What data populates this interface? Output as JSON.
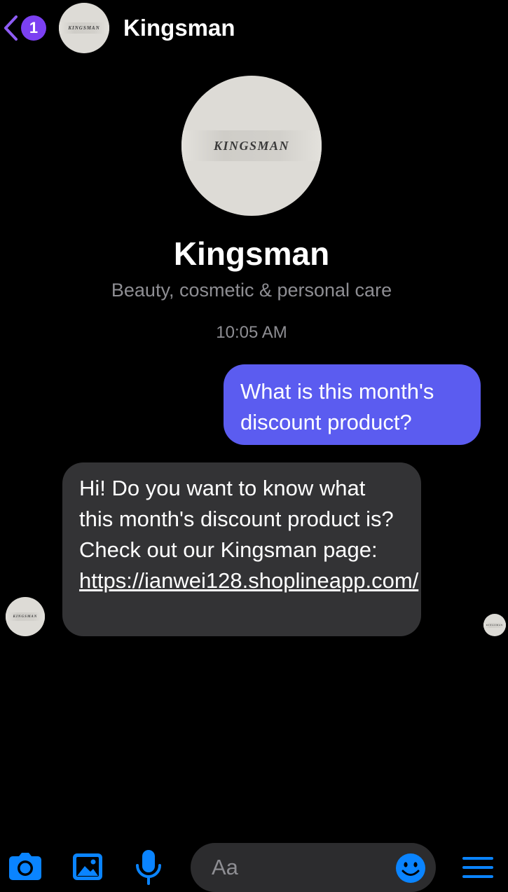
{
  "header": {
    "title": "Kingsman",
    "unread_count": "1",
    "avatar_text": "KINGSMAN"
  },
  "profile": {
    "name": "Kingsman",
    "category": "Beauty, cosmetic & personal care",
    "avatar_text": "KINGSMAN"
  },
  "conversation": {
    "timestamp": "10:05 AM",
    "messages": [
      {
        "direction": "outgoing",
        "text": "What is this month's discount product?"
      },
      {
        "direction": "incoming",
        "text": "Hi! Do you want to know what this month's discount product is? Check out our Kingsman page: ",
        "link": "https://ianwei128.shoplineapp.com/"
      }
    ],
    "sender_avatar_text": "KINGSMAN",
    "seen_avatar_text": "KINGSMAN"
  },
  "composer": {
    "placeholder": "Aa",
    "icons": [
      "camera-icon",
      "gallery-icon",
      "microphone-icon",
      "emoji-icon",
      "menu-icon"
    ]
  },
  "colors": {
    "accent": "#0a84ff",
    "badge": "#7b40f2",
    "outgoing_bubble": "#5b5cf0",
    "incoming_bubble": "#333335",
    "secondary_text": "#8e8e93"
  }
}
